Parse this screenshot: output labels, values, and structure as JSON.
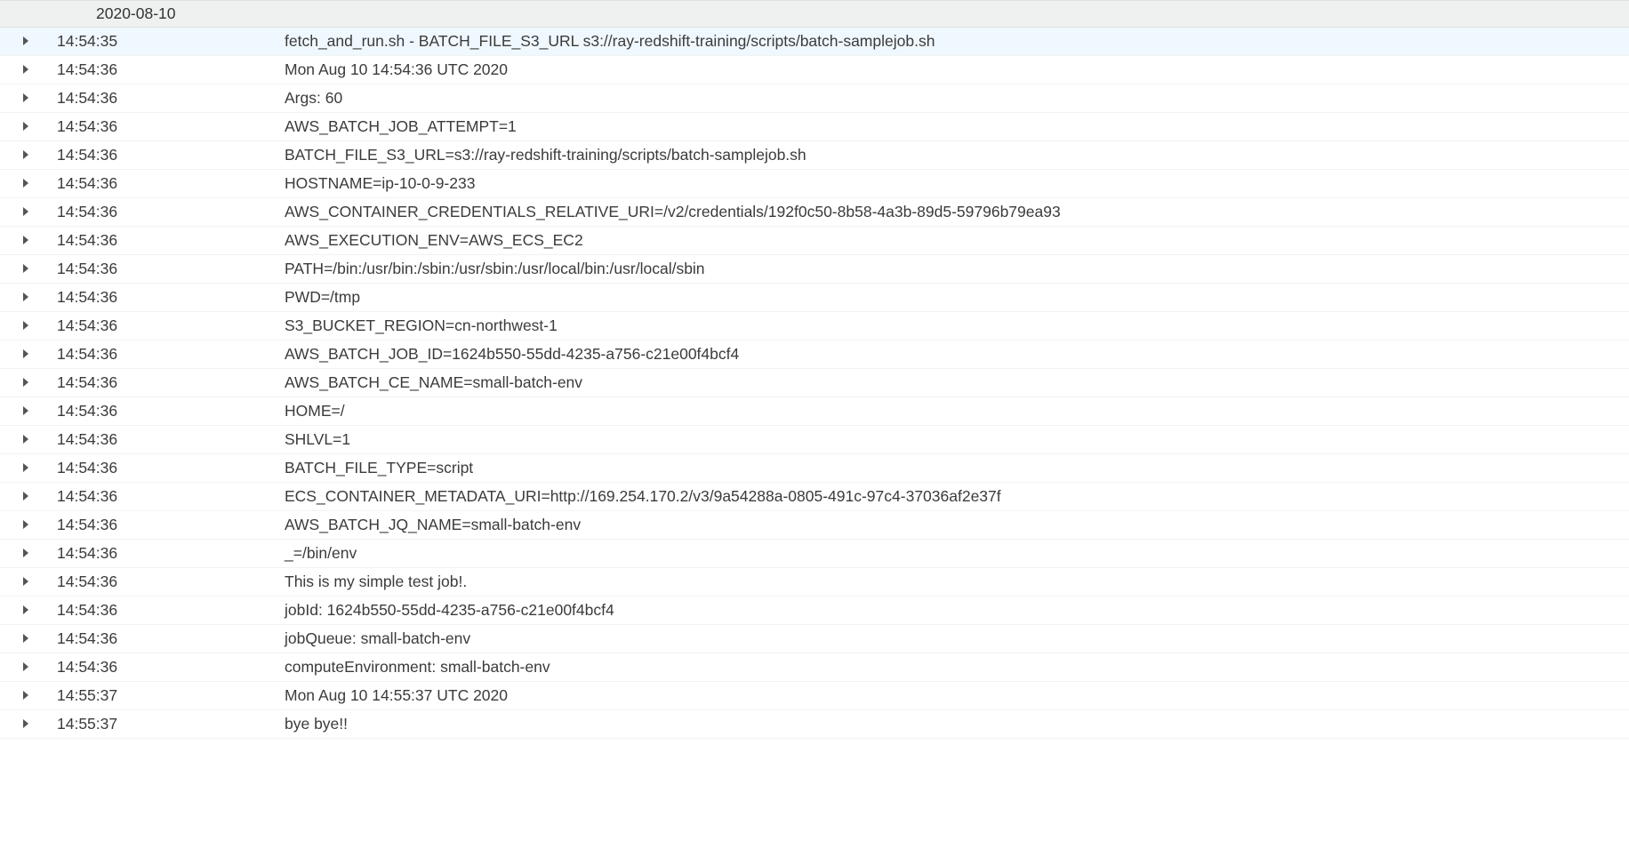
{
  "dateHeader": "2020-08-10",
  "rows": [
    {
      "time": "14:54:35",
      "message": "fetch_and_run.sh - BATCH_FILE_S3_URL s3://ray-redshift-training/scripts/batch-samplejob.sh",
      "highlighted": true
    },
    {
      "time": "14:54:36",
      "message": "Mon Aug 10 14:54:36 UTC 2020"
    },
    {
      "time": "14:54:36",
      "message": "Args: 60"
    },
    {
      "time": "14:54:36",
      "message": "AWS_BATCH_JOB_ATTEMPT=1"
    },
    {
      "time": "14:54:36",
      "message": "BATCH_FILE_S3_URL=s3://ray-redshift-training/scripts/batch-samplejob.sh"
    },
    {
      "time": "14:54:36",
      "message": "HOSTNAME=ip-10-0-9-233"
    },
    {
      "time": "14:54:36",
      "message": "AWS_CONTAINER_CREDENTIALS_RELATIVE_URI=/v2/credentials/192f0c50-8b58-4a3b-89d5-59796b79ea93"
    },
    {
      "time": "14:54:36",
      "message": "AWS_EXECUTION_ENV=AWS_ECS_EC2"
    },
    {
      "time": "14:54:36",
      "message": "PATH=/bin:/usr/bin:/sbin:/usr/sbin:/usr/local/bin:/usr/local/sbin"
    },
    {
      "time": "14:54:36",
      "message": "PWD=/tmp"
    },
    {
      "time": "14:54:36",
      "message": "S3_BUCKET_REGION=cn-northwest-1"
    },
    {
      "time": "14:54:36",
      "message": "AWS_BATCH_JOB_ID=1624b550-55dd-4235-a756-c21e00f4bcf4"
    },
    {
      "time": "14:54:36",
      "message": "AWS_BATCH_CE_NAME=small-batch-env"
    },
    {
      "time": "14:54:36",
      "message": "HOME=/"
    },
    {
      "time": "14:54:36",
      "message": "SHLVL=1"
    },
    {
      "time": "14:54:36",
      "message": "BATCH_FILE_TYPE=script"
    },
    {
      "time": "14:54:36",
      "message": "ECS_CONTAINER_METADATA_URI=http://169.254.170.2/v3/9a54288a-0805-491c-97c4-37036af2e37f"
    },
    {
      "time": "14:54:36",
      "message": "AWS_BATCH_JQ_NAME=small-batch-env"
    },
    {
      "time": "14:54:36",
      "message": "_=/bin/env"
    },
    {
      "time": "14:54:36",
      "message": "This is my simple test job!."
    },
    {
      "time": "14:54:36",
      "message": "jobId: 1624b550-55dd-4235-a756-c21e00f4bcf4"
    },
    {
      "time": "14:54:36",
      "message": "jobQueue: small-batch-env"
    },
    {
      "time": "14:54:36",
      "message": "computeEnvironment: small-batch-env"
    },
    {
      "time": "14:55:37",
      "message": "Mon Aug 10 14:55:37 UTC 2020"
    },
    {
      "time": "14:55:37",
      "message": "bye bye!!"
    }
  ]
}
